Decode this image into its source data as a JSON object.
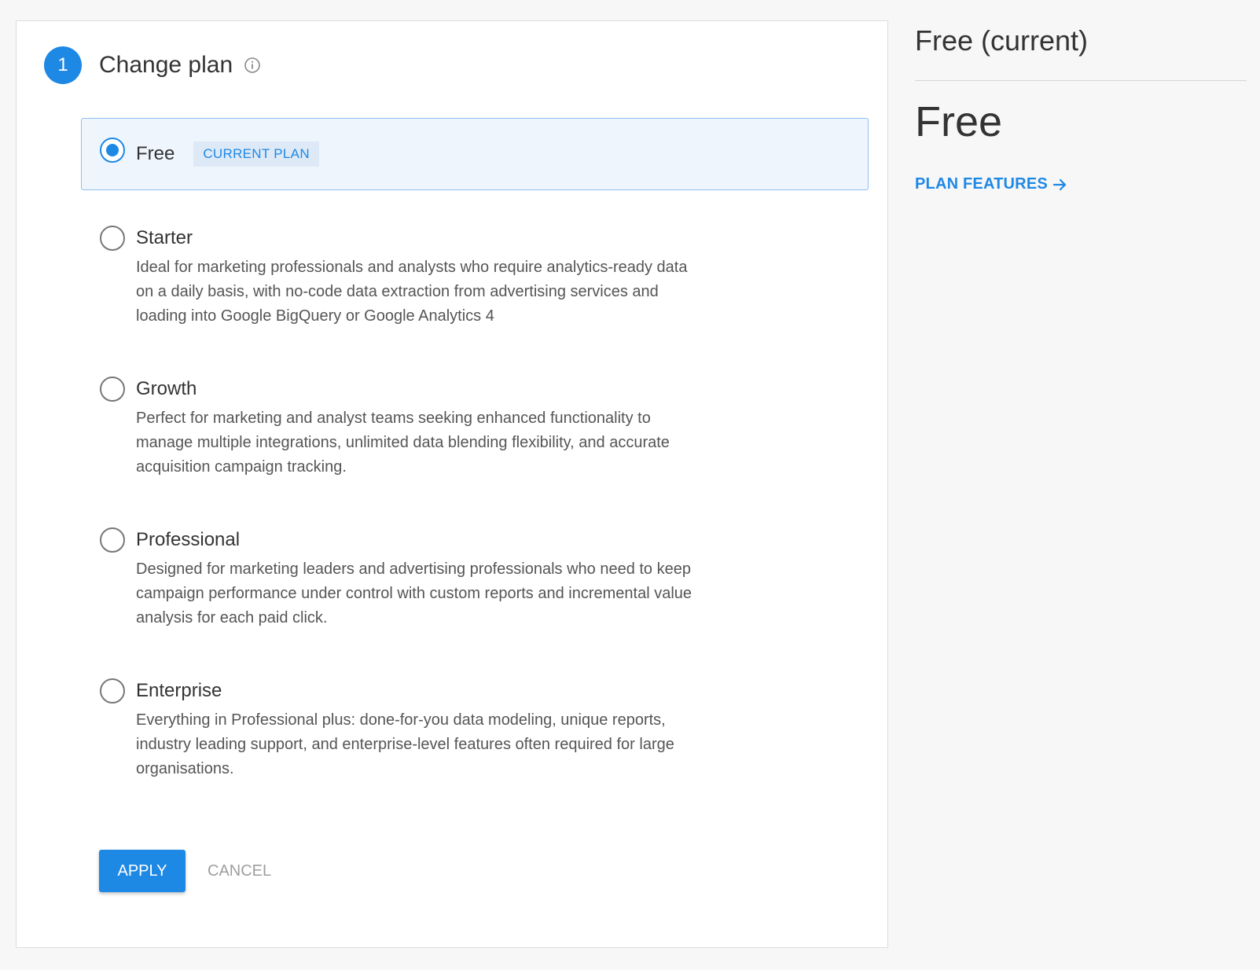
{
  "step": {
    "number": "1",
    "title": "Change plan",
    "info_icon": "info-icon"
  },
  "plans": {
    "selected": {
      "name": "Free",
      "badge": "CURRENT PLAN"
    },
    "options": [
      {
        "name": "Starter",
        "description": "Ideal for marketing professionals and analysts who require analytics-ready data on a daily basis, with no-code data extraction from advertising services and loading into Google BigQuery or Google Analytics 4"
      },
      {
        "name": "Growth",
        "description": "Perfect for marketing and analyst teams seeking enhanced functionality to manage multiple integrations, unlimited data blending flexibility, and accurate acquisition campaign tracking."
      },
      {
        "name": "Professional",
        "description": "Designed for marketing leaders and advertising professionals who need to keep campaign performance under control with custom reports and incremental value analysis for each paid click."
      },
      {
        "name": "Enterprise",
        "description": "Everything in Professional plus: done-for-you data modeling, unique reports, industry leading support, and enterprise-level features often required for large organisations."
      }
    ]
  },
  "actions": {
    "apply_label": "APPLY",
    "cancel_label": "CANCEL"
  },
  "side": {
    "title": "Free (current)",
    "plan_name": "Free",
    "features_link": "PLAN FEATURES",
    "link_icon": "arrow-right-icon"
  },
  "colors": {
    "accent": "#1e88e5",
    "selected_bg": "#eef5fd",
    "badge_bg": "#dde9f6"
  }
}
